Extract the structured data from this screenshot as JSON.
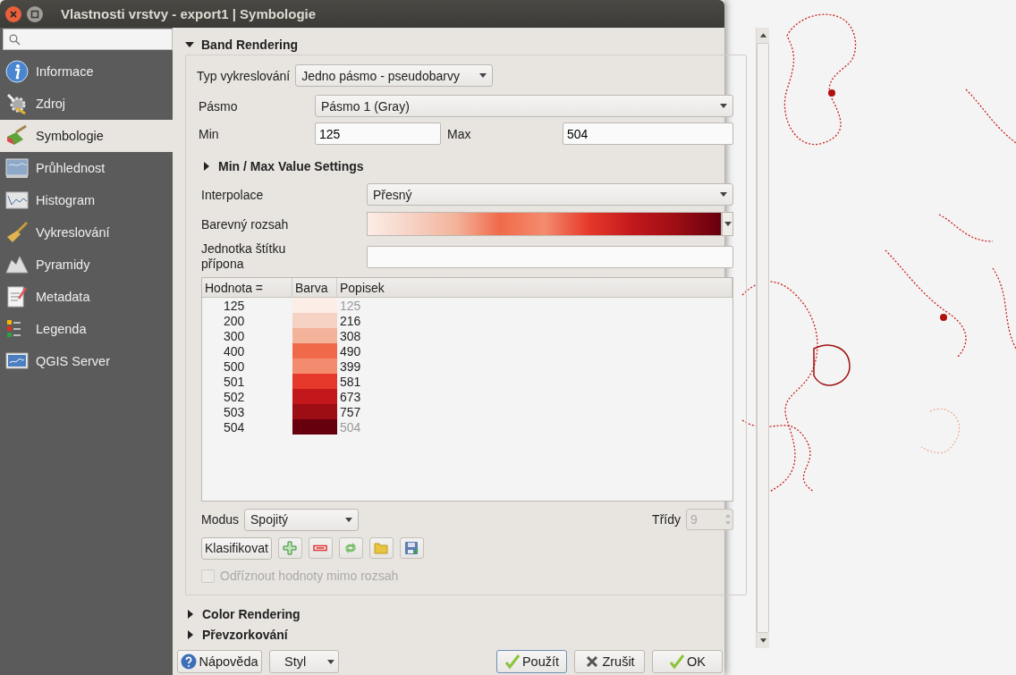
{
  "window": {
    "title": "Vlastnosti vrstvy - export1 | Symbologie"
  },
  "sidebar": {
    "items": [
      {
        "label": "Informace",
        "selected": false
      },
      {
        "label": "Zdroj",
        "selected": false
      },
      {
        "label": "Symbologie",
        "selected": true
      },
      {
        "label": "Průhlednost",
        "selected": false
      },
      {
        "label": "Histogram",
        "selected": false
      },
      {
        "label": "Vykreslování",
        "selected": false
      },
      {
        "label": "Pyramidy",
        "selected": false
      },
      {
        "label": "Metadata",
        "selected": false
      },
      {
        "label": "Legenda",
        "selected": false
      },
      {
        "label": "QGIS Server",
        "selected": false
      }
    ]
  },
  "band_rendering": {
    "title": "Band Rendering",
    "expanded": true,
    "render_type": {
      "label": "Typ vykreslování",
      "value": "Jedno pásmo - pseudobarvy"
    },
    "band": {
      "label": "Pásmo",
      "value": "Pásmo 1 (Gray)"
    },
    "min": {
      "label": "Min",
      "value": "125"
    },
    "max": {
      "label": "Max",
      "value": "504"
    },
    "minmax_settings": {
      "title": "Min / Max Value Settings",
      "expanded": false
    },
    "interpolation": {
      "label": "Interpolace",
      "value": "Přesný"
    },
    "color_ramp": {
      "label": "Barevný rozsah"
    },
    "label_suffix": {
      "label": "Jednotka štítku přípona"
    },
    "table": {
      "columns": [
        "Hodnota =",
        "Barva",
        "Popisek"
      ],
      "rows": [
        {
          "value": "125",
          "color": "#fcede6",
          "label": "125",
          "dimmed": true
        },
        {
          "value": "200",
          "color": "#f6d2c4",
          "label": "216",
          "dimmed": false
        },
        {
          "value": "300",
          "color": "#f3b39b",
          "label": "308",
          "dimmed": false
        },
        {
          "value": "400",
          "color": "#f06a4a",
          "label": "490",
          "dimmed": false
        },
        {
          "value": "500",
          "color": "#f38c6e",
          "label": "399",
          "dimmed": false
        },
        {
          "value": "501",
          "color": "#e6392b",
          "label": "581",
          "dimmed": false
        },
        {
          "value": "502",
          "color": "#c2181c",
          "label": "673",
          "dimmed": false
        },
        {
          "value": "503",
          "color": "#9c0d14",
          "label": "757",
          "dimmed": false
        },
        {
          "value": "504",
          "color": "#67000d",
          "label": "504",
          "dimmed": true
        }
      ]
    },
    "mode": {
      "label": "Modus",
      "value": "Spojitý"
    },
    "classes": {
      "label": "Třídy",
      "value": "9",
      "disabled": true
    },
    "classify_button": "Klasifikovat",
    "clip": {
      "label": "Odříznout hodnoty mimo rozsah",
      "checked": false,
      "disabled": true
    }
  },
  "sections": [
    {
      "title": "Color Rendering",
      "expanded": false
    },
    {
      "title": "Převzorkování",
      "expanded": false
    }
  ],
  "buttons": {
    "help": "Nápověda",
    "style": "Styl",
    "apply": "Použít",
    "cancel": "Zrušit",
    "ok": "OK"
  }
}
